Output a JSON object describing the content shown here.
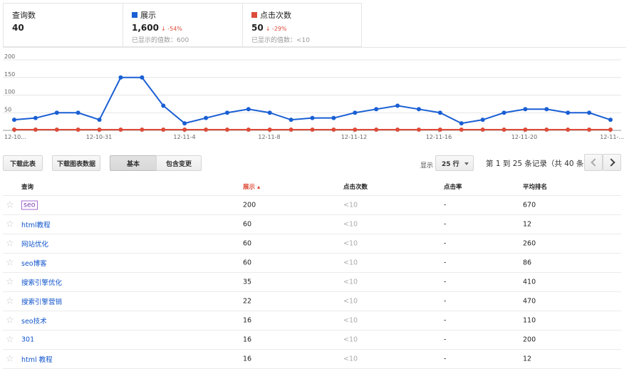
{
  "summary": {
    "queries": {
      "label": "查询数",
      "value": "40"
    },
    "impressions": {
      "label": "展示",
      "value": "1,600",
      "delta": "-54%",
      "sub": "已显示的值数：600",
      "color": "#1a5fd3"
    },
    "clicks": {
      "label": "点击次数",
      "value": "50",
      "delta": "-29%",
      "sub": "已显示的值数：<10",
      "color": "#dd4b39"
    }
  },
  "chart_data": {
    "type": "line",
    "ylim": [
      0,
      200
    ],
    "yticks": [
      "200",
      "150",
      "100",
      "50"
    ],
    "x_tick_labels": [
      "12-10...",
      "12-10-31",
      "12-11-4",
      "12-11-8",
      "12-11-12",
      "12-11-16",
      "12-11-20",
      "12-11-..."
    ],
    "series": [
      {
        "name": "展示",
        "color": "#1a5fd3",
        "values": [
          30,
          35,
          50,
          50,
          30,
          150,
          150,
          70,
          20,
          35,
          50,
          60,
          50,
          30,
          35,
          35,
          50,
          60,
          70,
          60,
          50,
          20,
          30,
          50,
          60,
          60,
          50,
          50,
          30
        ]
      },
      {
        "name": "点击次数",
        "color": "#dd4b39",
        "values": [
          2,
          2,
          2,
          2,
          2,
          2,
          2,
          2,
          2,
          2,
          2,
          2,
          2,
          2,
          2,
          2,
          2,
          2,
          2,
          2,
          2,
          2,
          2,
          2,
          2,
          2,
          2,
          2,
          2
        ]
      }
    ]
  },
  "toolbar": {
    "download_table": "下载此表",
    "download_chart": "下载图表数据",
    "basic": "基本",
    "with_change": "包含变更",
    "show_label": "显示",
    "rows_value": "25 行",
    "range_text": "第 1 到 25 条记录（共 40 条）"
  },
  "table": {
    "headers": {
      "query": "查询",
      "impressions": "展示",
      "clicks": "点击次数",
      "ctr": "点击率",
      "avg_pos": "平均排名"
    },
    "rows": [
      {
        "query": "seo",
        "impressions": "200",
        "clicks": "<10",
        "ctr": "-",
        "avg_pos": "670"
      },
      {
        "query": "html教程",
        "impressions": "60",
        "clicks": "<10",
        "ctr": "-",
        "avg_pos": "12"
      },
      {
        "query": "网站优化",
        "impressions": "60",
        "clicks": "<10",
        "ctr": "-",
        "avg_pos": "260"
      },
      {
        "query": "seo博客",
        "impressions": "60",
        "clicks": "<10",
        "ctr": "-",
        "avg_pos": "86"
      },
      {
        "query": "搜索引擎优化",
        "impressions": "35",
        "clicks": "<10",
        "ctr": "-",
        "avg_pos": "410"
      },
      {
        "query": "搜索引擎营销",
        "impressions": "22",
        "clicks": "<10",
        "ctr": "-",
        "avg_pos": "470"
      },
      {
        "query": "seo技术",
        "impressions": "16",
        "clicks": "<10",
        "ctr": "-",
        "avg_pos": "110"
      },
      {
        "query": "301",
        "impressions": "16",
        "clicks": "<10",
        "ctr": "-",
        "avg_pos": "200"
      },
      {
        "query": "html 教程",
        "impressions": "16",
        "clicks": "<10",
        "ctr": "-",
        "avg_pos": "12"
      }
    ]
  }
}
